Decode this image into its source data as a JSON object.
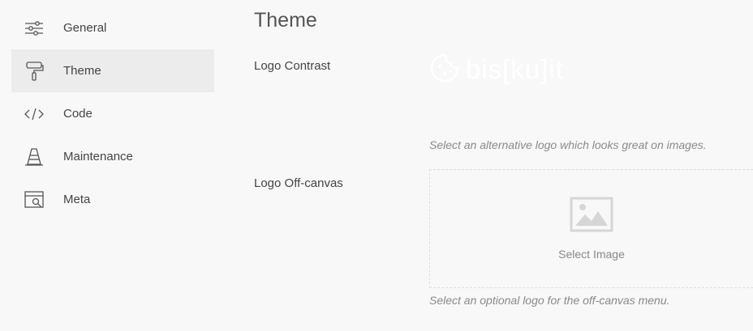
{
  "sidebar": {
    "items": [
      {
        "label": "General",
        "icon": "sliders-icon"
      },
      {
        "label": "Theme",
        "icon": "paint-roller-icon",
        "active": true
      },
      {
        "label": "Code",
        "icon": "code-icon"
      },
      {
        "label": "Maintenance",
        "icon": "traffic-cone-icon"
      },
      {
        "label": "Meta",
        "icon": "browser-search-icon"
      }
    ]
  },
  "main": {
    "title": "Theme",
    "logo_contrast": {
      "label": "Logo Contrast",
      "logo_text": "bis[ku]it",
      "help": "Select an alternative logo which looks great on images."
    },
    "logo_offcanvas": {
      "label": "Logo Off-canvas",
      "picker_label": "Select Image",
      "help": "Select an optional logo for the off-canvas menu."
    }
  },
  "colors": {
    "background": "#f8f8f9",
    "active_item": "#ececec",
    "logo_white": "#ffffff"
  }
}
